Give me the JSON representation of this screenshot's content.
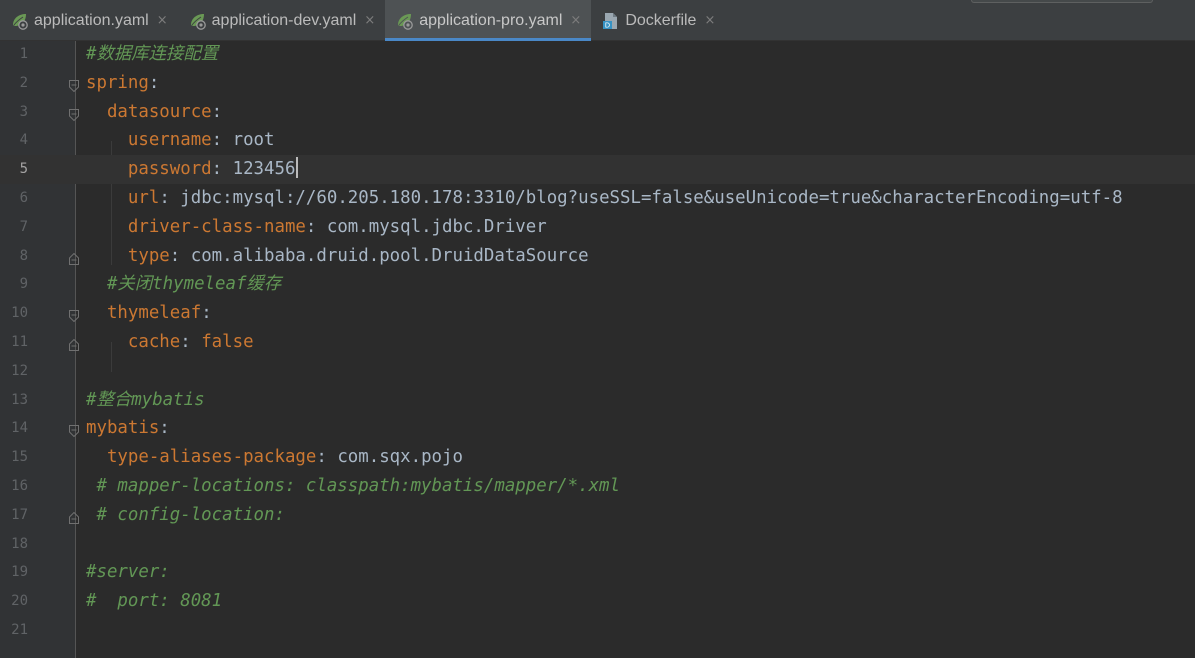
{
  "tabs": [
    {
      "label": "application.yaml",
      "icon": "spring-yaml-icon",
      "active": false
    },
    {
      "label": "application-dev.yaml",
      "icon": "spring-yaml-icon",
      "active": false
    },
    {
      "label": "application-pro.yaml",
      "icon": "spring-yaml-icon",
      "active": true
    },
    {
      "label": "Dockerfile",
      "icon": "dockerfile-icon",
      "active": false
    }
  ],
  "tab_close_glyph": "×",
  "editor": {
    "current_line": 5,
    "lines": [
      {
        "n": "1",
        "tokens": [
          {
            "t": "c",
            "s": "#数据库连接配置"
          }
        ]
      },
      {
        "n": "2",
        "tokens": [
          {
            "t": "k",
            "s": "spring"
          },
          {
            "t": "p",
            "s": ":"
          }
        ]
      },
      {
        "n": "3",
        "tokens": [
          {
            "t": "p",
            "s": "  "
          },
          {
            "t": "k",
            "s": "datasource"
          },
          {
            "t": "p",
            "s": ":"
          }
        ]
      },
      {
        "n": "4",
        "tokens": [
          {
            "t": "p",
            "s": "    "
          },
          {
            "t": "k",
            "s": "username"
          },
          {
            "t": "p",
            "s": ": "
          },
          {
            "t": "v",
            "s": "root"
          }
        ]
      },
      {
        "n": "5",
        "tokens": [
          {
            "t": "p",
            "s": "    "
          },
          {
            "t": "k",
            "s": "password"
          },
          {
            "t": "p",
            "s": ": "
          },
          {
            "t": "v",
            "s": "123456"
          }
        ]
      },
      {
        "n": "6",
        "tokens": [
          {
            "t": "p",
            "s": "    "
          },
          {
            "t": "k",
            "s": "url"
          },
          {
            "t": "p",
            "s": ": "
          },
          {
            "t": "v",
            "s": "jdbc:mysql://60.205.180.178:3310/blog?useSSL=false&useUnicode=true&characterEncoding=utf-8"
          }
        ]
      },
      {
        "n": "7",
        "tokens": [
          {
            "t": "p",
            "s": "    "
          },
          {
            "t": "k",
            "s": "driver-class-name"
          },
          {
            "t": "p",
            "s": ": "
          },
          {
            "t": "v",
            "s": "com.mysql.jdbc.Driver"
          }
        ]
      },
      {
        "n": "8",
        "tokens": [
          {
            "t": "p",
            "s": "    "
          },
          {
            "t": "k",
            "s": "type"
          },
          {
            "t": "p",
            "s": ": "
          },
          {
            "t": "v",
            "s": "com.alibaba.druid.pool.DruidDataSource"
          }
        ]
      },
      {
        "n": "9",
        "tokens": [
          {
            "t": "p",
            "s": "  "
          },
          {
            "t": "c",
            "s": "#关闭thymeleaf缓存"
          }
        ]
      },
      {
        "n": "10",
        "tokens": [
          {
            "t": "p",
            "s": "  "
          },
          {
            "t": "k",
            "s": "thymeleaf"
          },
          {
            "t": "p",
            "s": ":"
          }
        ]
      },
      {
        "n": "11",
        "tokens": [
          {
            "t": "p",
            "s": "    "
          },
          {
            "t": "k",
            "s": "cache"
          },
          {
            "t": "p",
            "s": ": "
          },
          {
            "t": "kw",
            "s": "false"
          }
        ]
      },
      {
        "n": "12",
        "tokens": []
      },
      {
        "n": "13",
        "tokens": [
          {
            "t": "c",
            "s": "#整合mybatis"
          }
        ]
      },
      {
        "n": "14",
        "tokens": [
          {
            "t": "k",
            "s": "mybatis"
          },
          {
            "t": "p",
            "s": ":"
          }
        ]
      },
      {
        "n": "15",
        "tokens": [
          {
            "t": "p",
            "s": "  "
          },
          {
            "t": "k",
            "s": "type-aliases-package"
          },
          {
            "t": "p",
            "s": ": "
          },
          {
            "t": "v",
            "s": "com.sqx.pojo"
          }
        ]
      },
      {
        "n": "16",
        "tokens": [
          {
            "t": "p",
            "s": " "
          },
          {
            "t": "c",
            "s": "# mapper-locations: classpath:mybatis/mapper/*.xml"
          }
        ]
      },
      {
        "n": "17",
        "tokens": [
          {
            "t": "p",
            "s": " "
          },
          {
            "t": "c",
            "s": "# config-location:"
          }
        ]
      },
      {
        "n": "18",
        "tokens": []
      },
      {
        "n": "19",
        "tokens": [
          {
            "t": "c",
            "s": "#server:"
          }
        ]
      },
      {
        "n": "20",
        "tokens": [
          {
            "t": "c",
            "s": "#  port: 8081"
          }
        ]
      },
      {
        "n": "21",
        "tokens": []
      }
    ],
    "folds": {
      "2": "open",
      "3": "open",
      "8": "close",
      "10": "open",
      "11": "close",
      "14": "open",
      "17": "close"
    }
  },
  "colors": {
    "background": "#2b2b2b",
    "gutter": "#313335",
    "key": "#cc7832",
    "value": "#a9b7c6",
    "comment": "#629755",
    "active_tab_underline": "#4a88c7"
  }
}
